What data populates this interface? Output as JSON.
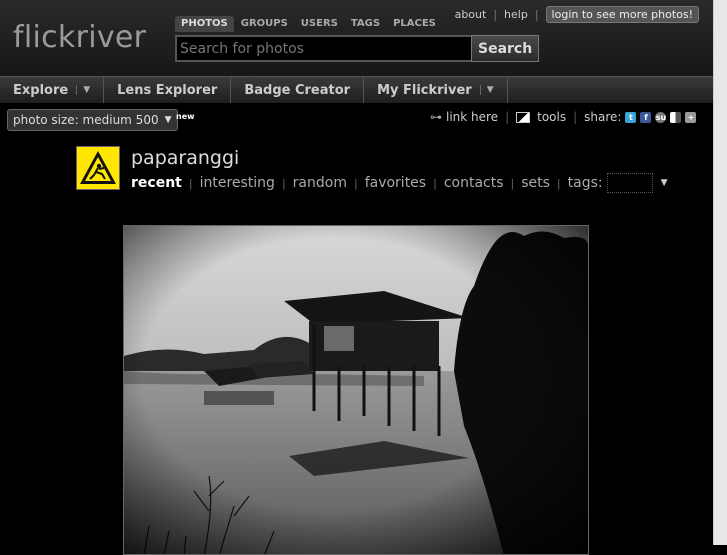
{
  "header": {
    "logo": "flickriver",
    "search_tabs": [
      "PHOTOS",
      "GROUPS",
      "USERS",
      "TAGS",
      "PLACES"
    ],
    "search_placeholder": "Search for photos",
    "search_button": "Search",
    "links": {
      "about": "about",
      "help": "help",
      "login": "login to see more photos!"
    }
  },
  "nav": {
    "items": [
      {
        "label": "Explore"
      },
      {
        "label": "Lens Explorer"
      },
      {
        "label": "Badge Creator"
      },
      {
        "label": "My Flickriver"
      }
    ]
  },
  "toolbar": {
    "photo_size": "photo size: medium 500",
    "new_badge": "new",
    "link_here": "link here",
    "tools": "tools",
    "share": "share:",
    "share_icons": [
      "twitter-icon",
      "facebook-icon",
      "stumbleupon-icon",
      "delicious-icon",
      "more-share-icon"
    ]
  },
  "user": {
    "name": "paparanggi",
    "tabs": [
      "recent",
      "interesting",
      "random",
      "favorites",
      "contacts",
      "sets"
    ],
    "tags_label": "tags:"
  },
  "colors": {
    "accent_avatar": "#ffe600",
    "background": "#000000"
  }
}
